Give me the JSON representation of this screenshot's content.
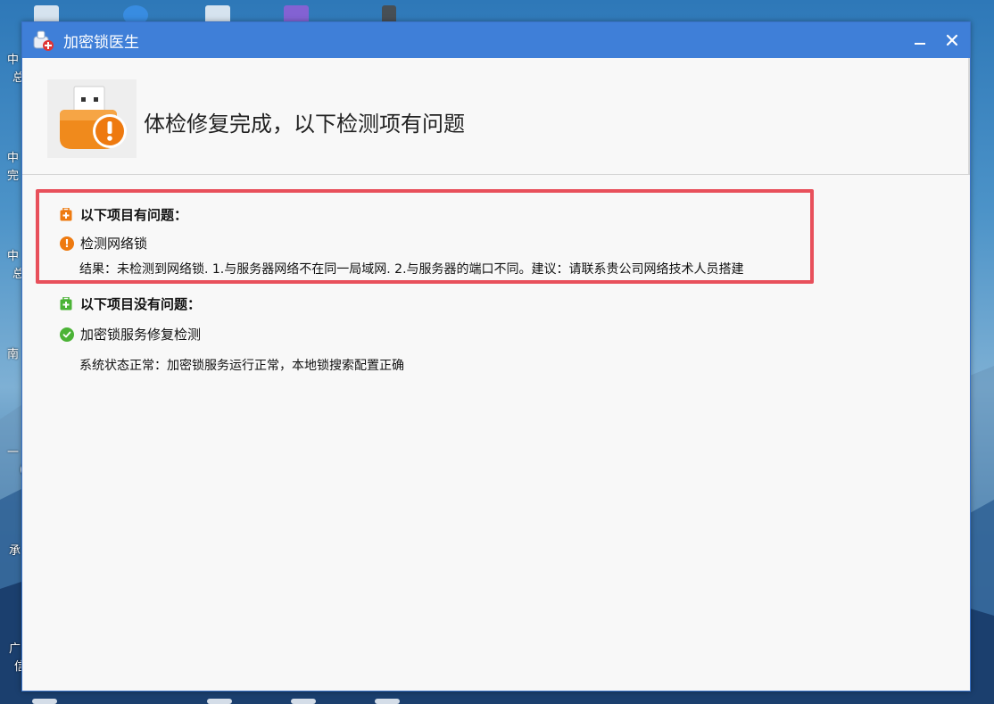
{
  "window": {
    "title": "加密锁医生",
    "minimize_glyph": "−",
    "close_glyph": "✕"
  },
  "header": {
    "headline": "体检修复完成，以下检测项有问题"
  },
  "problems": {
    "title": "以下项目有问题：",
    "items": [
      {
        "name": "检测网络锁",
        "detail": "结果：未检测到网络锁. 1.与服务器网络不在同一局域网. 2.与服务器的端口不同。建议：请联系贵公司网络技术人员搭建"
      }
    ]
  },
  "ok": {
    "title": "以下项目没有问题：",
    "items": [
      {
        "name": "加密锁服务修复检测",
        "detail": "系统状态正常：加密锁服务运行正常，本地锁搜索配置正确"
      }
    ]
  },
  "desktop": {
    "left_labels": [
      "中",
      "总",
      "中",
      "完",
      "中",
      "总",
      "南",
      "一",
      "（",
      "承",
      "广",
      "信"
    ]
  },
  "colors": {
    "titlebar": "#3f7fd8",
    "warning": "#ee7a10",
    "success": "#4bb336",
    "highlight_border": "#e8505b"
  }
}
